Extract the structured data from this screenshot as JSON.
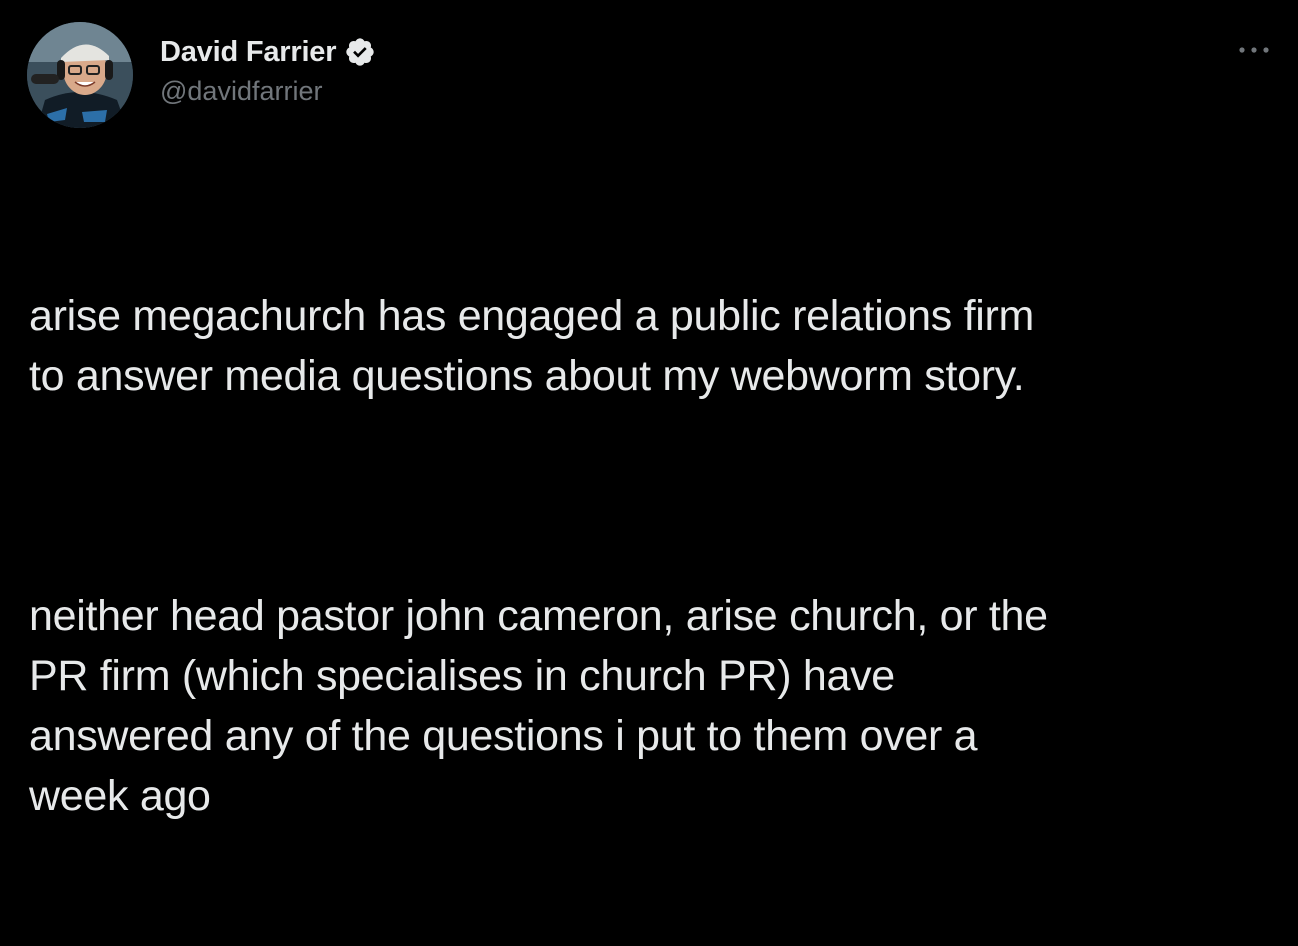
{
  "author": {
    "display_name": "David Farrier",
    "handle": "@davidfarrier",
    "verified": true,
    "avatar_icon": "profile-photo"
  },
  "tweet": {
    "paragraphs": [
      "arise megachurch has engaged a public relations firm\nto answer media questions about my webworm story.",
      "neither head pastor john cameron, arise church, or the\nPR firm (which specialises in church PR) have\nanswered any of the questions i put to them over a\nweek ago"
    ]
  },
  "icons": {
    "verified": "verified-badge-icon",
    "more": "more-options-icon"
  },
  "colors": {
    "background": "#000000",
    "text_primary": "#e7e9ea",
    "text_secondary": "#71767b"
  }
}
